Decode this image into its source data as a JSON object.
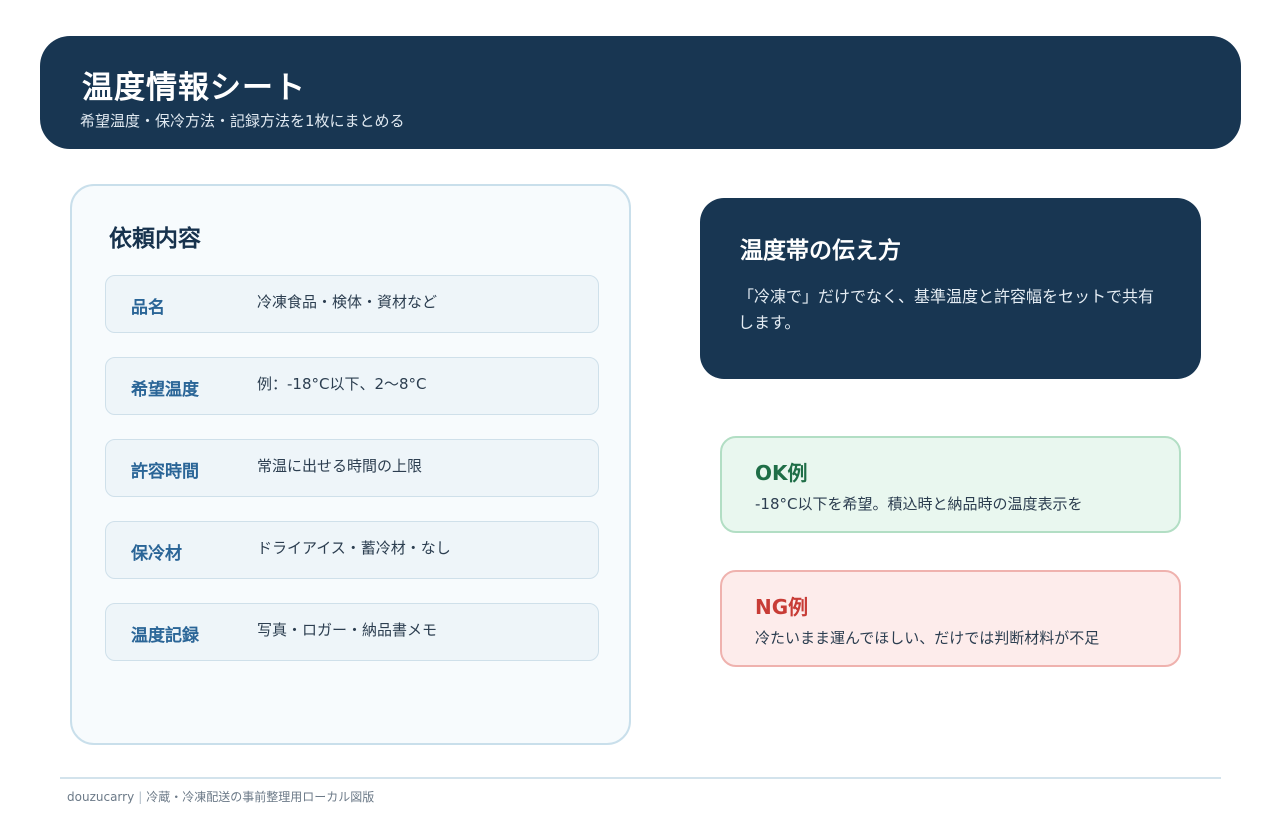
{
  "header": {
    "title": "温度情報シート",
    "subtitle": "希望温度・保冷方法・記録方法を1枚にまとめる"
  },
  "request": {
    "title": "依頼内容",
    "rows": [
      {
        "label": "品名",
        "value": "冷凍食品・検体・資材など"
      },
      {
        "label": "希望温度",
        "value": "例：-18°C以下、2〜8°C"
      },
      {
        "label": "許容時間",
        "value": "常温に出せる時間の上限"
      },
      {
        "label": "保冷材",
        "value": "ドライアイス・蓄冷材・なし"
      },
      {
        "label": "温度記録",
        "value": "写真・ロガー・納品書メモ"
      }
    ]
  },
  "info": {
    "title": "温度帯の伝え方",
    "body": "「冷凍で」だけでなく、基準温度と許容幅をセットで共有します。"
  },
  "examples": {
    "ok": {
      "title": "OK例",
      "text": "-18°C以下を希望。積込時と納品時の温度表示を"
    },
    "ng": {
      "title": "NG例",
      "text": "冷たいまま運んでほしい、だけでは判断材料が不足"
    }
  },
  "footer": {
    "brand": "douzucarry",
    "separator": "|",
    "caption": "冷蔵・冷凍配送の事前整理用ローカル図版"
  }
}
